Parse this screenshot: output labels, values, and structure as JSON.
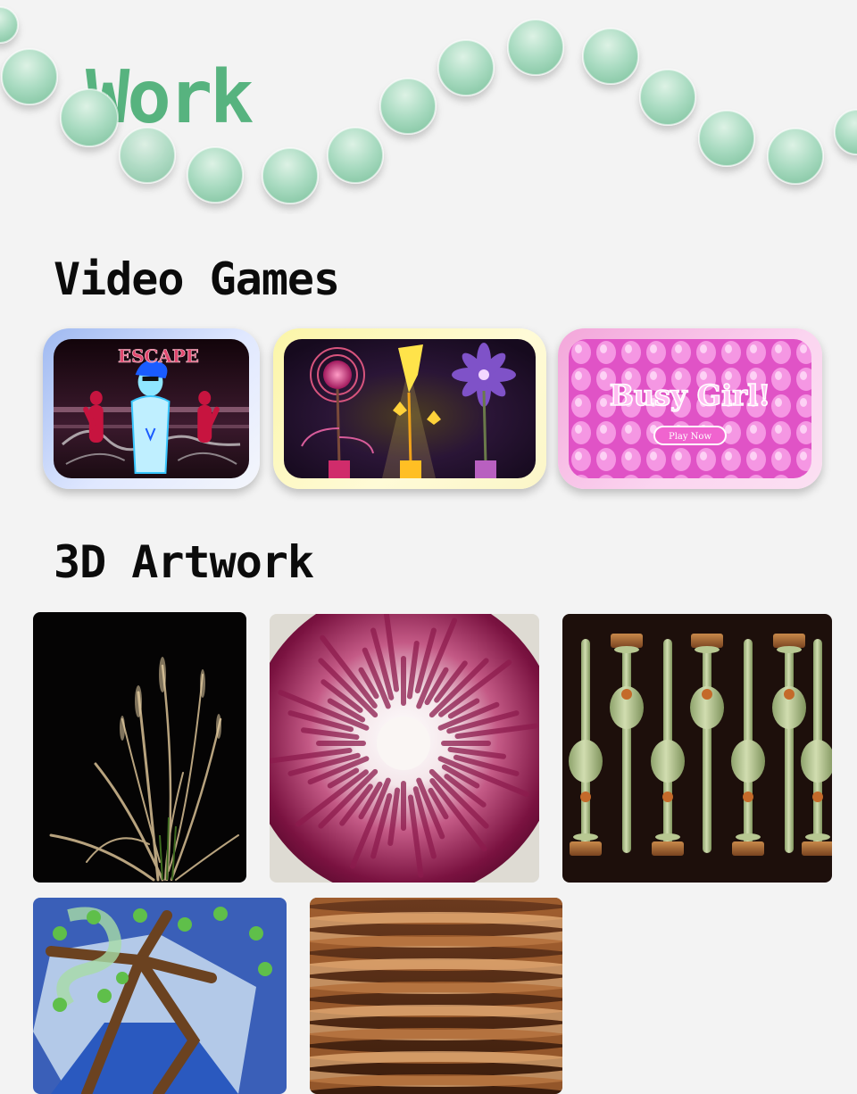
{
  "page": {
    "title": "Work",
    "title_color": "#57b37f",
    "decoration": "mint-green-bead-string"
  },
  "sections": [
    {
      "heading": "Video Games",
      "items": [
        {
          "title": "ESCAPE",
          "thumbnail": "escape-game-art",
          "frame_color": "#9fb9f1"
        },
        {
          "title": "",
          "thumbnail": "glowing-flowers-game-art",
          "frame_color": "#fbf5a8"
        },
        {
          "title": "Busy Girl!",
          "subtitle": "Play Now",
          "thumbnail": "busy-girl-game-art",
          "frame_color": "#f3a6da"
        }
      ]
    },
    {
      "heading": "3D Artwork",
      "items": [
        {
          "thumbnail": "golden-grass-render"
        },
        {
          "thumbnail": "magenta-radial-burst-render"
        },
        {
          "thumbnail": "green-vase-array-render"
        },
        {
          "thumbnail": "tree-on-blue-hexagon-render"
        },
        {
          "thumbnail": "copper-rings-render"
        }
      ]
    }
  ]
}
